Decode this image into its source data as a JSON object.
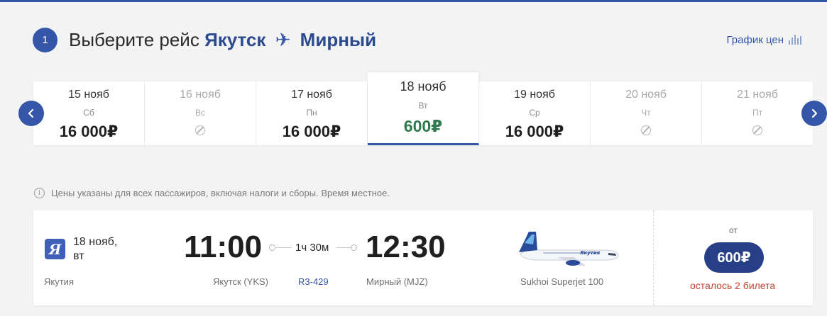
{
  "header": {
    "step_number": "1",
    "title_prefix": "Выберите рейс",
    "origin": "Якутск",
    "destination": "Мирный",
    "price_chart_label": "График цен"
  },
  "dates": [
    {
      "date": "15 нояб",
      "weekday": "Сб",
      "price": "16 000₽",
      "available": true,
      "active": false
    },
    {
      "date": "16 нояб",
      "weekday": "Вс",
      "price": "",
      "available": false,
      "active": false
    },
    {
      "date": "17 нояб",
      "weekday": "Пн",
      "price": "16 000₽",
      "available": true,
      "active": false
    },
    {
      "date": "18 нояб",
      "weekday": "Вт",
      "price": "600₽",
      "available": true,
      "active": true
    },
    {
      "date": "19 нояб",
      "weekday": "Ср",
      "price": "16 000₽",
      "available": true,
      "active": false
    },
    {
      "date": "20 нояб",
      "weekday": "Чт",
      "price": "",
      "available": false,
      "active": false
    },
    {
      "date": "21 нояб",
      "weekday": "Пт",
      "price": "",
      "available": false,
      "active": false
    }
  ],
  "info_note": "Цены указаны для всех пассажиров, включая налоги и сборы. Время местное.",
  "flight": {
    "date_line1": "18 нояб,",
    "date_line2": "вт",
    "airline": "Якутия",
    "airline_logo_letter": "Я",
    "departure_time": "11:00",
    "arrival_time": "12:30",
    "duration": "1ч 30м",
    "departure_airport": "Якутск (YKS)",
    "arrival_airport": "Мирный (MJZ)",
    "flight_number": "R3-429",
    "aircraft": "Sukhoi Superjet 100",
    "from_label": "от",
    "price": "600₽",
    "seats_left": "осталось 2 билета"
  },
  "colors": {
    "brand": "#3556a8",
    "active_price": "#2f7a4f",
    "price_button": "#263f86",
    "seats_warning": "#c8402f"
  },
  "icons": {
    "plane": "airplane-icon",
    "chart": "bar-chart-icon",
    "unavailable": "no-flights-icon",
    "info": "info-icon",
    "prev": "chevron-left-icon",
    "next": "chevron-right-icon"
  }
}
